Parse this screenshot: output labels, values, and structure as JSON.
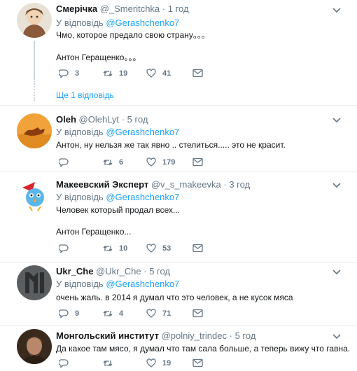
{
  "reply_prefix": "У відповідь",
  "tweets": [
    {
      "name": "Смерічка",
      "handle": "@_Smeritchka",
      "dot": "·",
      "time": "1 год",
      "reply_to": "@Gerashchenko7",
      "lines": [
        "Чмо, которое предало свою страну。。。",
        "Антон Геращенко。。。"
      ],
      "replies": "3",
      "retweets": "19",
      "likes": "41",
      "more_replies": "Ще 1 відповідь"
    },
    {
      "name": "Oleh",
      "handle": "@OlehLyt",
      "dot": "·",
      "time": "5 год",
      "reply_to": "@Gerashchenko7",
      "lines": [
        "Антон, ну нельзя же так явно .. стелиться..... это не красит."
      ],
      "replies": "",
      "retweets": "6",
      "likes": "179"
    },
    {
      "name": "Макеевский Эксперт",
      "handle": "@v_s_makeevka",
      "dot": "·",
      "time": "3 год",
      "reply_to": "@Gerashchenko7",
      "lines": [
        "Человек который продал всех...",
        "Антон Геращенко..."
      ],
      "replies": "",
      "retweets": "10",
      "likes": "53"
    },
    {
      "name": "Ukr_Che",
      "handle": "@Ukr_Che",
      "dot": "·",
      "time": "5 год",
      "reply_to": "@Gerashchenko7",
      "lines": [
        "очень жаль. в 2014 я думал что это человек, а не кусок мяса"
      ],
      "replies": "9",
      "retweets": "4",
      "likes": "71"
    },
    {
      "name": "Монгольский институт",
      "handle": "@polniy_trindec",
      "dot": "·",
      "time": "5 год",
      "lines": [
        "Да какое там мясо, я думал что там сала больше, а теперь вижу что гавна."
      ],
      "replies": "",
      "retweets": "",
      "likes": "19"
    }
  ],
  "colors": {
    "accent": "#1da1f2",
    "muted": "#657786",
    "border": "#e6ecf0"
  },
  "icons": {
    "reply": "reply-icon",
    "retweet": "retweet-icon",
    "like": "heart-icon",
    "dm": "envelope-icon",
    "menu": "chevron-down-icon"
  }
}
